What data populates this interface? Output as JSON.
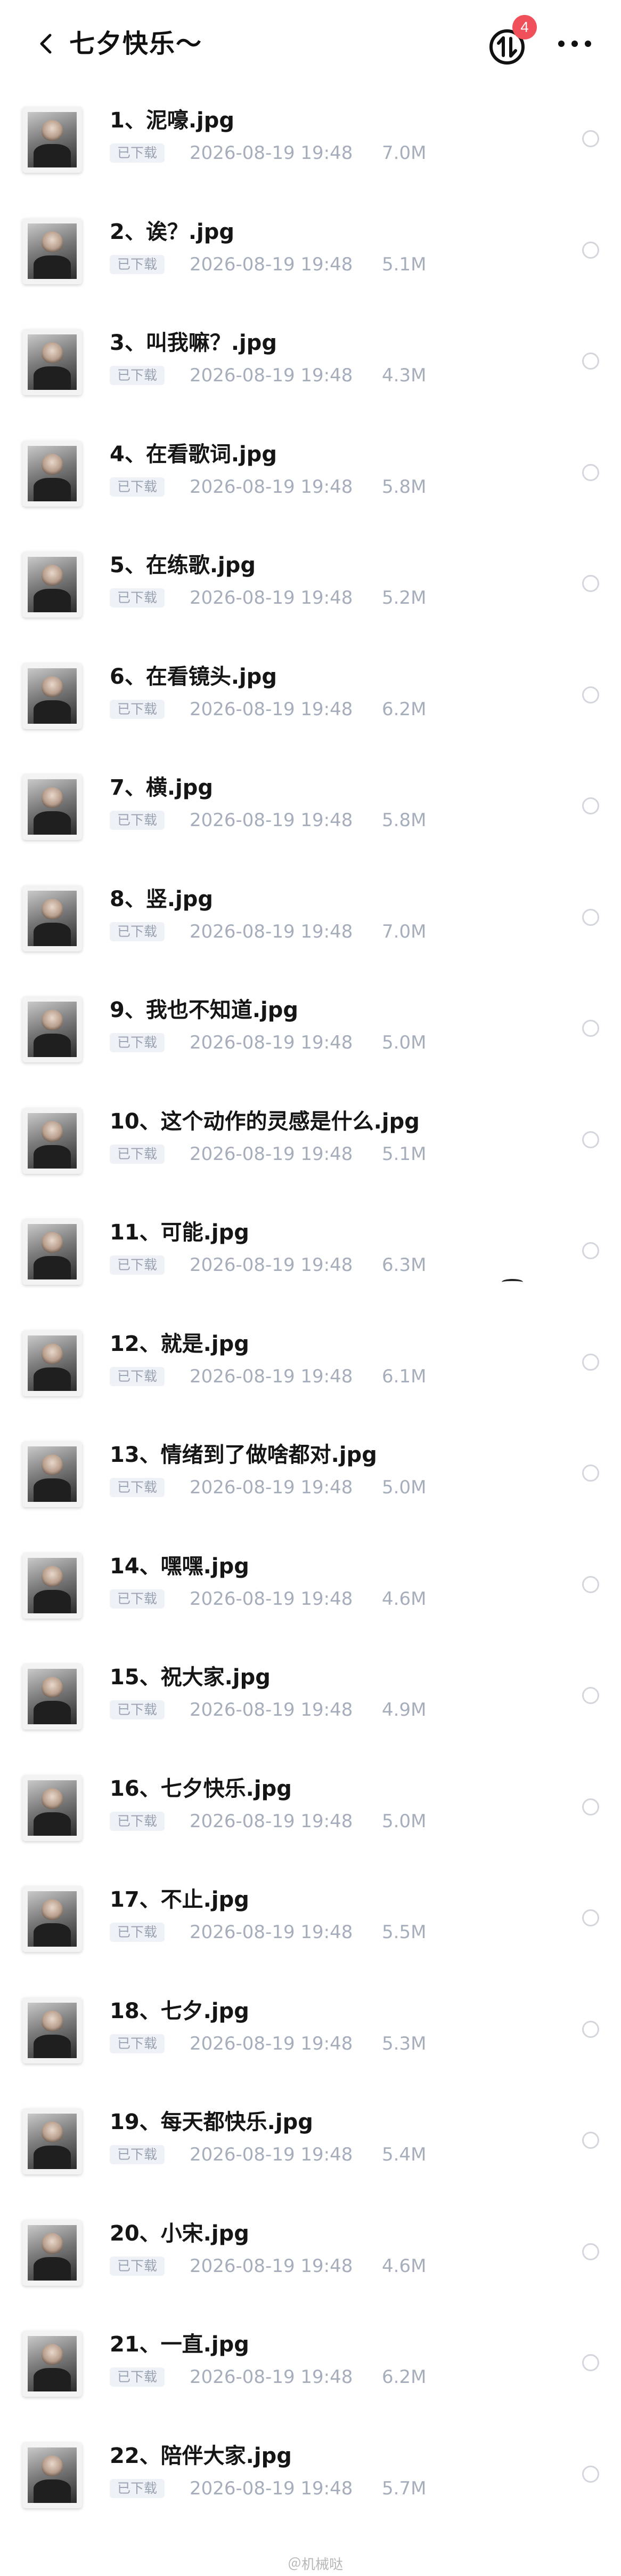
{
  "header": {
    "title": "七夕快乐～",
    "back_icon": "chevron-left-icon",
    "transfer_icon": "transfer-arrows-icon",
    "transfer_badge": "4",
    "more_icon": "more-horizontal-icon",
    "badge_color": "#f0505a"
  },
  "files": [
    {
      "name": "1、泥嚎.jpg",
      "status": "已下载",
      "date": "2026-08-19 19:48",
      "size": "7.0M"
    },
    {
      "name": "2、诶？.jpg",
      "status": "已下载",
      "date": "2026-08-19 19:48",
      "size": "5.1M"
    },
    {
      "name": "3、叫我嘛？.jpg",
      "status": "已下载",
      "date": "2026-08-19 19:48",
      "size": "4.3M"
    },
    {
      "name": "4、在看歌词.jpg",
      "status": "已下载",
      "date": "2026-08-19 19:48",
      "size": "5.8M"
    },
    {
      "name": "5、在练歌.jpg",
      "status": "已下载",
      "date": "2026-08-19 19:48",
      "size": "5.2M"
    },
    {
      "name": "6、在看镜头.jpg",
      "status": "已下载",
      "date": "2026-08-19 19:48",
      "size": "6.2M"
    },
    {
      "name": "7、横.jpg",
      "status": "已下载",
      "date": "2026-08-19 19:48",
      "size": "5.8M"
    },
    {
      "name": "8、竖.jpg",
      "status": "已下载",
      "date": "2026-08-19 19:48",
      "size": "7.0M"
    },
    {
      "name": "9、我也不知道.jpg",
      "status": "已下载",
      "date": "2026-08-19 19:48",
      "size": "5.0M"
    },
    {
      "name": "10、这个动作的灵感是什么.jpg",
      "status": "已下载",
      "date": "2026-08-19 19:48",
      "size": "5.1M"
    },
    {
      "name": "11、可能.jpg",
      "status": "已下载",
      "date": "2026-08-19 19:48",
      "size": "6.3M"
    },
    {
      "name": "12、就是.jpg",
      "status": "已下载",
      "date": "2026-08-19 19:48",
      "size": "6.1M"
    },
    {
      "name": "13、情绪到了做啥都对.jpg",
      "status": "已下载",
      "date": "2026-08-19 19:48",
      "size": "5.0M"
    },
    {
      "name": "14、嘿嘿.jpg",
      "status": "已下载",
      "date": "2026-08-19 19:48",
      "size": "4.6M"
    },
    {
      "name": "15、祝大家.jpg",
      "status": "已下载",
      "date": "2026-08-19 19:48",
      "size": "4.9M"
    },
    {
      "name": "16、七夕快乐.jpg",
      "status": "已下载",
      "date": "2026-08-19 19:48",
      "size": "5.0M"
    },
    {
      "name": "17、不止.jpg",
      "status": "已下载",
      "date": "2026-08-19 19:48",
      "size": "5.5M"
    },
    {
      "name": "18、七夕.jpg",
      "status": "已下载",
      "date": "2026-08-19 19:48",
      "size": "5.3M"
    },
    {
      "name": "19、每天都快乐.jpg",
      "status": "已下载",
      "date": "2026-08-19 19:48",
      "size": "5.4M"
    },
    {
      "name": "20、小宋.jpg",
      "status": "已下载",
      "date": "2026-08-19 19:48",
      "size": "4.6M"
    },
    {
      "name": "21、一直.jpg",
      "status": "已下载",
      "date": "2026-08-19 19:48",
      "size": "6.2M"
    },
    {
      "name": "22、陪伴大家.jpg",
      "status": "已下载",
      "date": "2026-08-19 19:48",
      "size": "5.7M"
    }
  ],
  "icons": {
    "thumbnail": "photo-thumbnail-icon",
    "select": "radio-circle-icon"
  },
  "watermark": "＠机械哒"
}
